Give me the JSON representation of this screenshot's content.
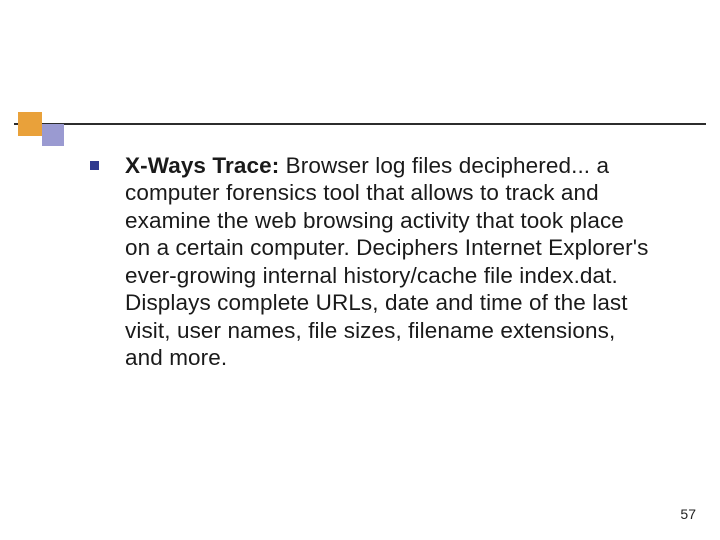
{
  "slide": {
    "bullets": [
      {
        "bold_lead": "X-Ways Trace:",
        "rest": " Browser log files deciphered... a computer forensics tool that allows to track and examine the web browsing activity that took place on a certain computer. Deciphers Internet Explorer's ever-growing internal history/cache file index.dat. Displays complete URLs, date and time of the last visit, user names, file sizes, filename extensions, and more."
      }
    ],
    "page_number": "57"
  }
}
